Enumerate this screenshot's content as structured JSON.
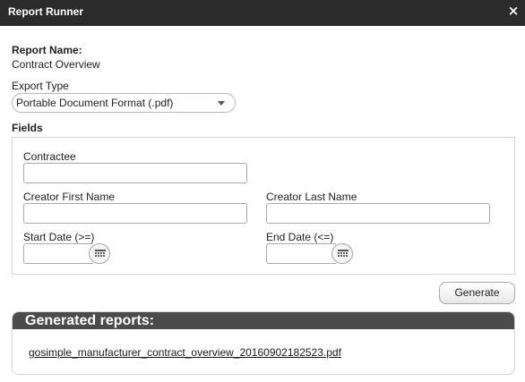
{
  "window": {
    "title": "Report Runner",
    "close_glyph": "×"
  },
  "report": {
    "name_label": "Report Name:",
    "name_value": "Contract Overview"
  },
  "export": {
    "label": "Export Type",
    "selected": "Portable Document Format (.pdf)"
  },
  "fields": {
    "section_label": "Fields",
    "contractee_label": "Contractee",
    "contractee_value": "",
    "creator_first_label": "Creator First Name",
    "creator_first_value": "",
    "creator_last_label": "Creator Last Name",
    "creator_last_value": "",
    "start_date_label": "Start Date (>=)",
    "start_date_value": "",
    "end_date_label": "End Date (<=)",
    "end_date_value": ""
  },
  "actions": {
    "generate_label": "Generate"
  },
  "generated": {
    "header": "Generated reports:",
    "files": [
      "gosimple_manufacturer_contract_overview_20160902182523.pdf"
    ]
  },
  "icons": {
    "close": "close-icon",
    "dropdown": "chevron-down-icon",
    "calendar": "calendar-icon"
  },
  "colors": {
    "titlebar": "#2b2b2b",
    "reports_header": "#4b4b4b"
  }
}
